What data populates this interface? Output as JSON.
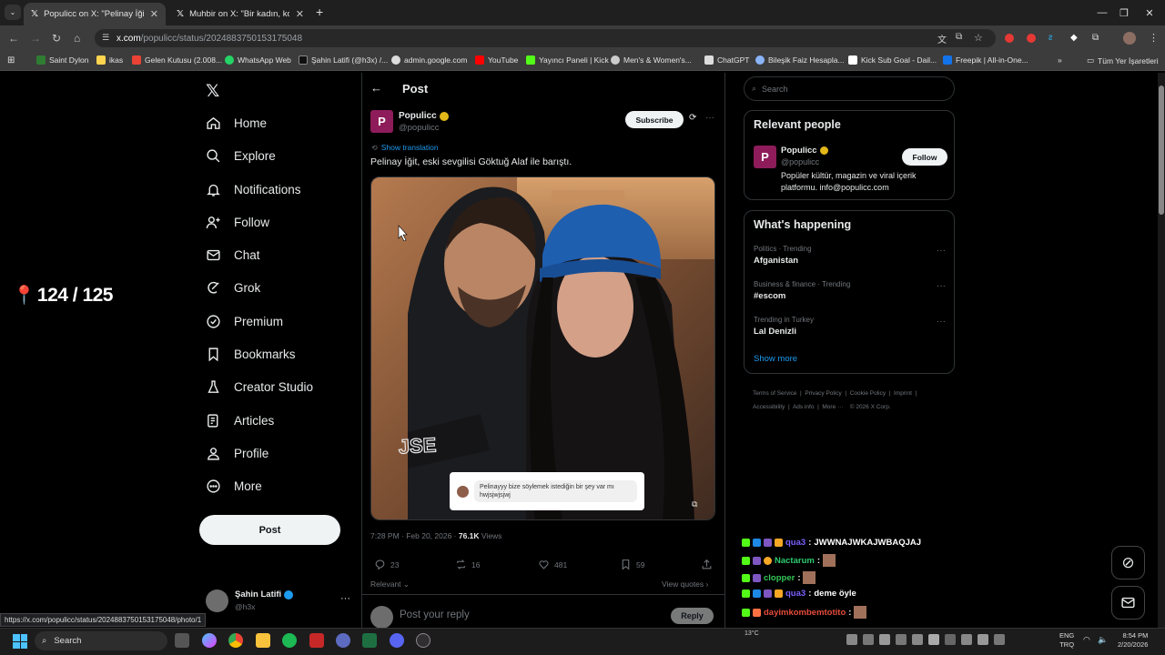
{
  "browser": {
    "tabs": [
      {
        "title": "Populicc on X: \"Pelinay İğit, eski",
        "active": true
      },
      {
        "title": "Muhbir on X: \"Bir kadın, ko",
        "active": false
      }
    ],
    "url_domain": "x.com",
    "url_path": "/populicc/status/2024883750153175048",
    "status_url": "https://x.com/populicc/status/2024883750153175048/photo/1",
    "bookmarks": [
      {
        "label": "Saint Dylon",
        "color": "#2e7d32"
      },
      {
        "label": "ikas",
        "color": "#ffd54f"
      },
      {
        "label": "Gelen Kutusu (2.008...",
        "color": "#ea4335"
      },
      {
        "label": "WhatsApp Web",
        "color": "#25d366"
      },
      {
        "label": "Şahin Latifi (@h3x) /...",
        "color": "#111111"
      },
      {
        "label": "admin.google.com",
        "color": "#dddddd"
      },
      {
        "label": "YouTube",
        "color": "#ff0000"
      },
      {
        "label": "Yayıncı Paneli | Kick",
        "color": "#53fc18"
      },
      {
        "label": "Men's & Women's...",
        "color": "#cccccc"
      },
      {
        "label": "ChatGPT",
        "color": "#dddddd"
      },
      {
        "label": "Bileşik Faiz Hesapla...",
        "color": "#8ab4f8"
      },
      {
        "label": "Kick Sub Goal - Dail...",
        "color": "#ffffff"
      },
      {
        "label": "Freepik | All-in-One...",
        "color": "#1273eb"
      }
    ],
    "all_bookmarks": "Tüm Yer İşaretleri"
  },
  "overlay": {
    "counter": "124 / 125"
  },
  "nav": {
    "items": [
      "Home",
      "Explore",
      "Notifications",
      "Follow",
      "Chat",
      "Grok",
      "Premium",
      "Bookmarks",
      "Creator Studio",
      "Articles",
      "Profile",
      "More"
    ],
    "post_button": "Post",
    "account": {
      "name": "Şahin Latifi",
      "handle": "@h3x"
    }
  },
  "post": {
    "header_title": "Post",
    "author": {
      "name": "Populicc",
      "handle": "@populicc",
      "avatar_letter": "P"
    },
    "subscribe": "Subscribe",
    "show_translation": "Show translation",
    "text": "Pelinay İğit, eski sevgilisi Göktuğ Alaf ile barıştı.",
    "image_caption": "Pelinayyy bize söylemek istediğin bir şey var mı hwjsjwjsjwj",
    "hoodie_text": "JSE",
    "meta_time": "7:28 PM · Feb 20, 2026 · ",
    "views_count": "76.1K",
    "views_label": " Views",
    "stats": {
      "replies": "23",
      "reposts": "16",
      "likes": "481",
      "bookmarks": "59"
    },
    "relevant": "Relevant",
    "view_quotes": "View quotes",
    "reply_placeholder": "Post your reply",
    "reply_button": "Reply"
  },
  "sidebar": {
    "search_placeholder": "Search",
    "relevant_title": "Relevant people",
    "person": {
      "name": "Populicc",
      "handle": "@populicc",
      "bio": "Popüler kültür, magazin ve viral içerik platformu. info@populicc.com",
      "follow": "Follow"
    },
    "happening_title": "What's happening",
    "trends": [
      {
        "category": "Politics · Trending",
        "title": "Afganistan"
      },
      {
        "category": "Business & finance · Trending",
        "title": "#escom"
      },
      {
        "category": "Trending in Turkey",
        "title": "Lal Denizli"
      }
    ],
    "show_more": "Show more",
    "footer": [
      "Terms of Service",
      "Privacy Policy",
      "Cookie Policy",
      "Imprint",
      "Accessibility",
      "Ads info",
      "More ···",
      "© 2026 X Corp."
    ]
  },
  "chat": [
    {
      "user": "qua3",
      "color": "#7b61ff",
      "message": "JWWNAJWKAJWBAQJAJ"
    },
    {
      "user": "Nactarum",
      "color": "#2ecc71",
      "message": ""
    },
    {
      "user": "clopper",
      "color": "#34c759",
      "message": ""
    },
    {
      "user": "qua3",
      "color": "#7b61ff",
      "message": "deme öyle"
    },
    {
      "user": "dayimkombemtotito",
      "color": "#e74c3c",
      "message": ""
    }
  ],
  "taskbar": {
    "search": "Search",
    "lang": "ENG",
    "lang2": "TRQ",
    "time": "8:54 PM",
    "date": "2/20/2026",
    "temp": "13°C"
  }
}
